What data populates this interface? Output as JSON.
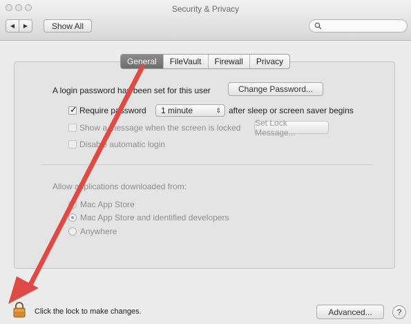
{
  "window": {
    "title": "Security & Privacy"
  },
  "toolbar": {
    "back_label": "◀",
    "forward_label": "▶",
    "show_all_label": "Show All",
    "search_placeholder": ""
  },
  "tabs": [
    {
      "label": "General",
      "active": true
    },
    {
      "label": "FileVault",
      "active": false
    },
    {
      "label": "Firewall",
      "active": false
    },
    {
      "label": "Privacy",
      "active": false
    }
  ],
  "general": {
    "login_password_text": "A login password has been set for this user",
    "change_password_label": "Change Password...",
    "require_password_label": "Require password",
    "require_password_checked": true,
    "require_password_delay": "1 minute",
    "after_sleep_text": "after sleep or screen saver begins",
    "show_message_label": "Show a message when the screen is locked",
    "set_lock_message_label": "Set Lock Message...",
    "disable_auto_login_label": "Disable automatic login",
    "allow_apps_label": "Allow applications downloaded from:",
    "options": [
      {
        "label": "Mac App Store",
        "selected": false
      },
      {
        "label": "Mac App Store and identified developers",
        "selected": true
      },
      {
        "label": "Anywhere",
        "selected": false
      }
    ]
  },
  "footer": {
    "lock_text": "Click the lock to make changes.",
    "advanced_label": "Advanced...",
    "help_label": "?"
  },
  "colors": {
    "annotation_arrow": "#e04a44",
    "lock": "#d98a2c",
    "active_tab": "#7a7a7a"
  }
}
